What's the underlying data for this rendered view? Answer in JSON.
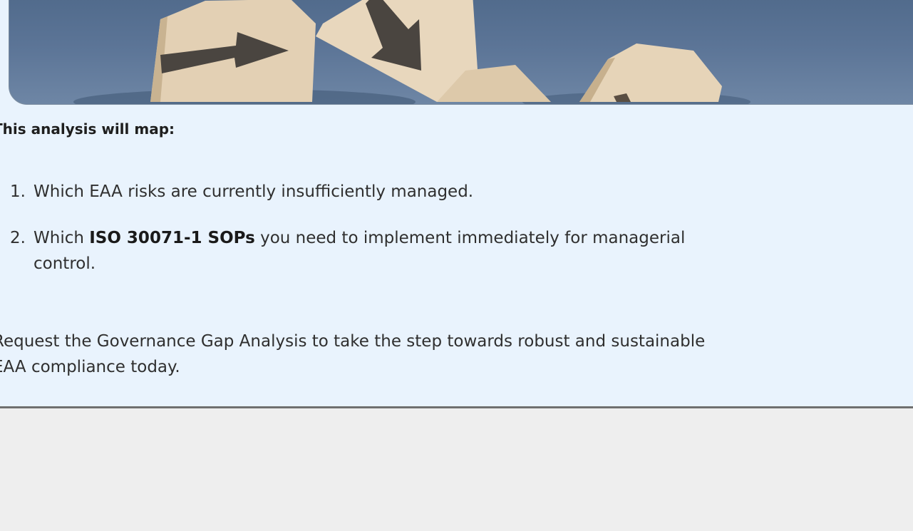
{
  "intro_heading": "This analysis will map:",
  "list": [
    {
      "number": "1.",
      "text": "Which EAA risks are currently insufficiently managed."
    },
    {
      "number": "2.",
      "prefix": "Which ",
      "bold": "ISO 30071-1 SOPs",
      "suffix": " you need to implement immediately for managerial",
      "continuation": "control."
    }
  ],
  "outro": {
    "line1": "Request the Governance Gap Analysis to take the step towards robust and sustainable",
    "line2": "EAA compliance today."
  },
  "colors": {
    "panel_background": "#e9f3fd",
    "page_background": "#eeeeee",
    "divider": "#6f6f6f",
    "hero_background": "#5a7393",
    "wood_block": "#e3d0b4",
    "arrow": "#4a4540"
  },
  "hero_image": {
    "icon": "wooden-blocks-arrows-image"
  }
}
